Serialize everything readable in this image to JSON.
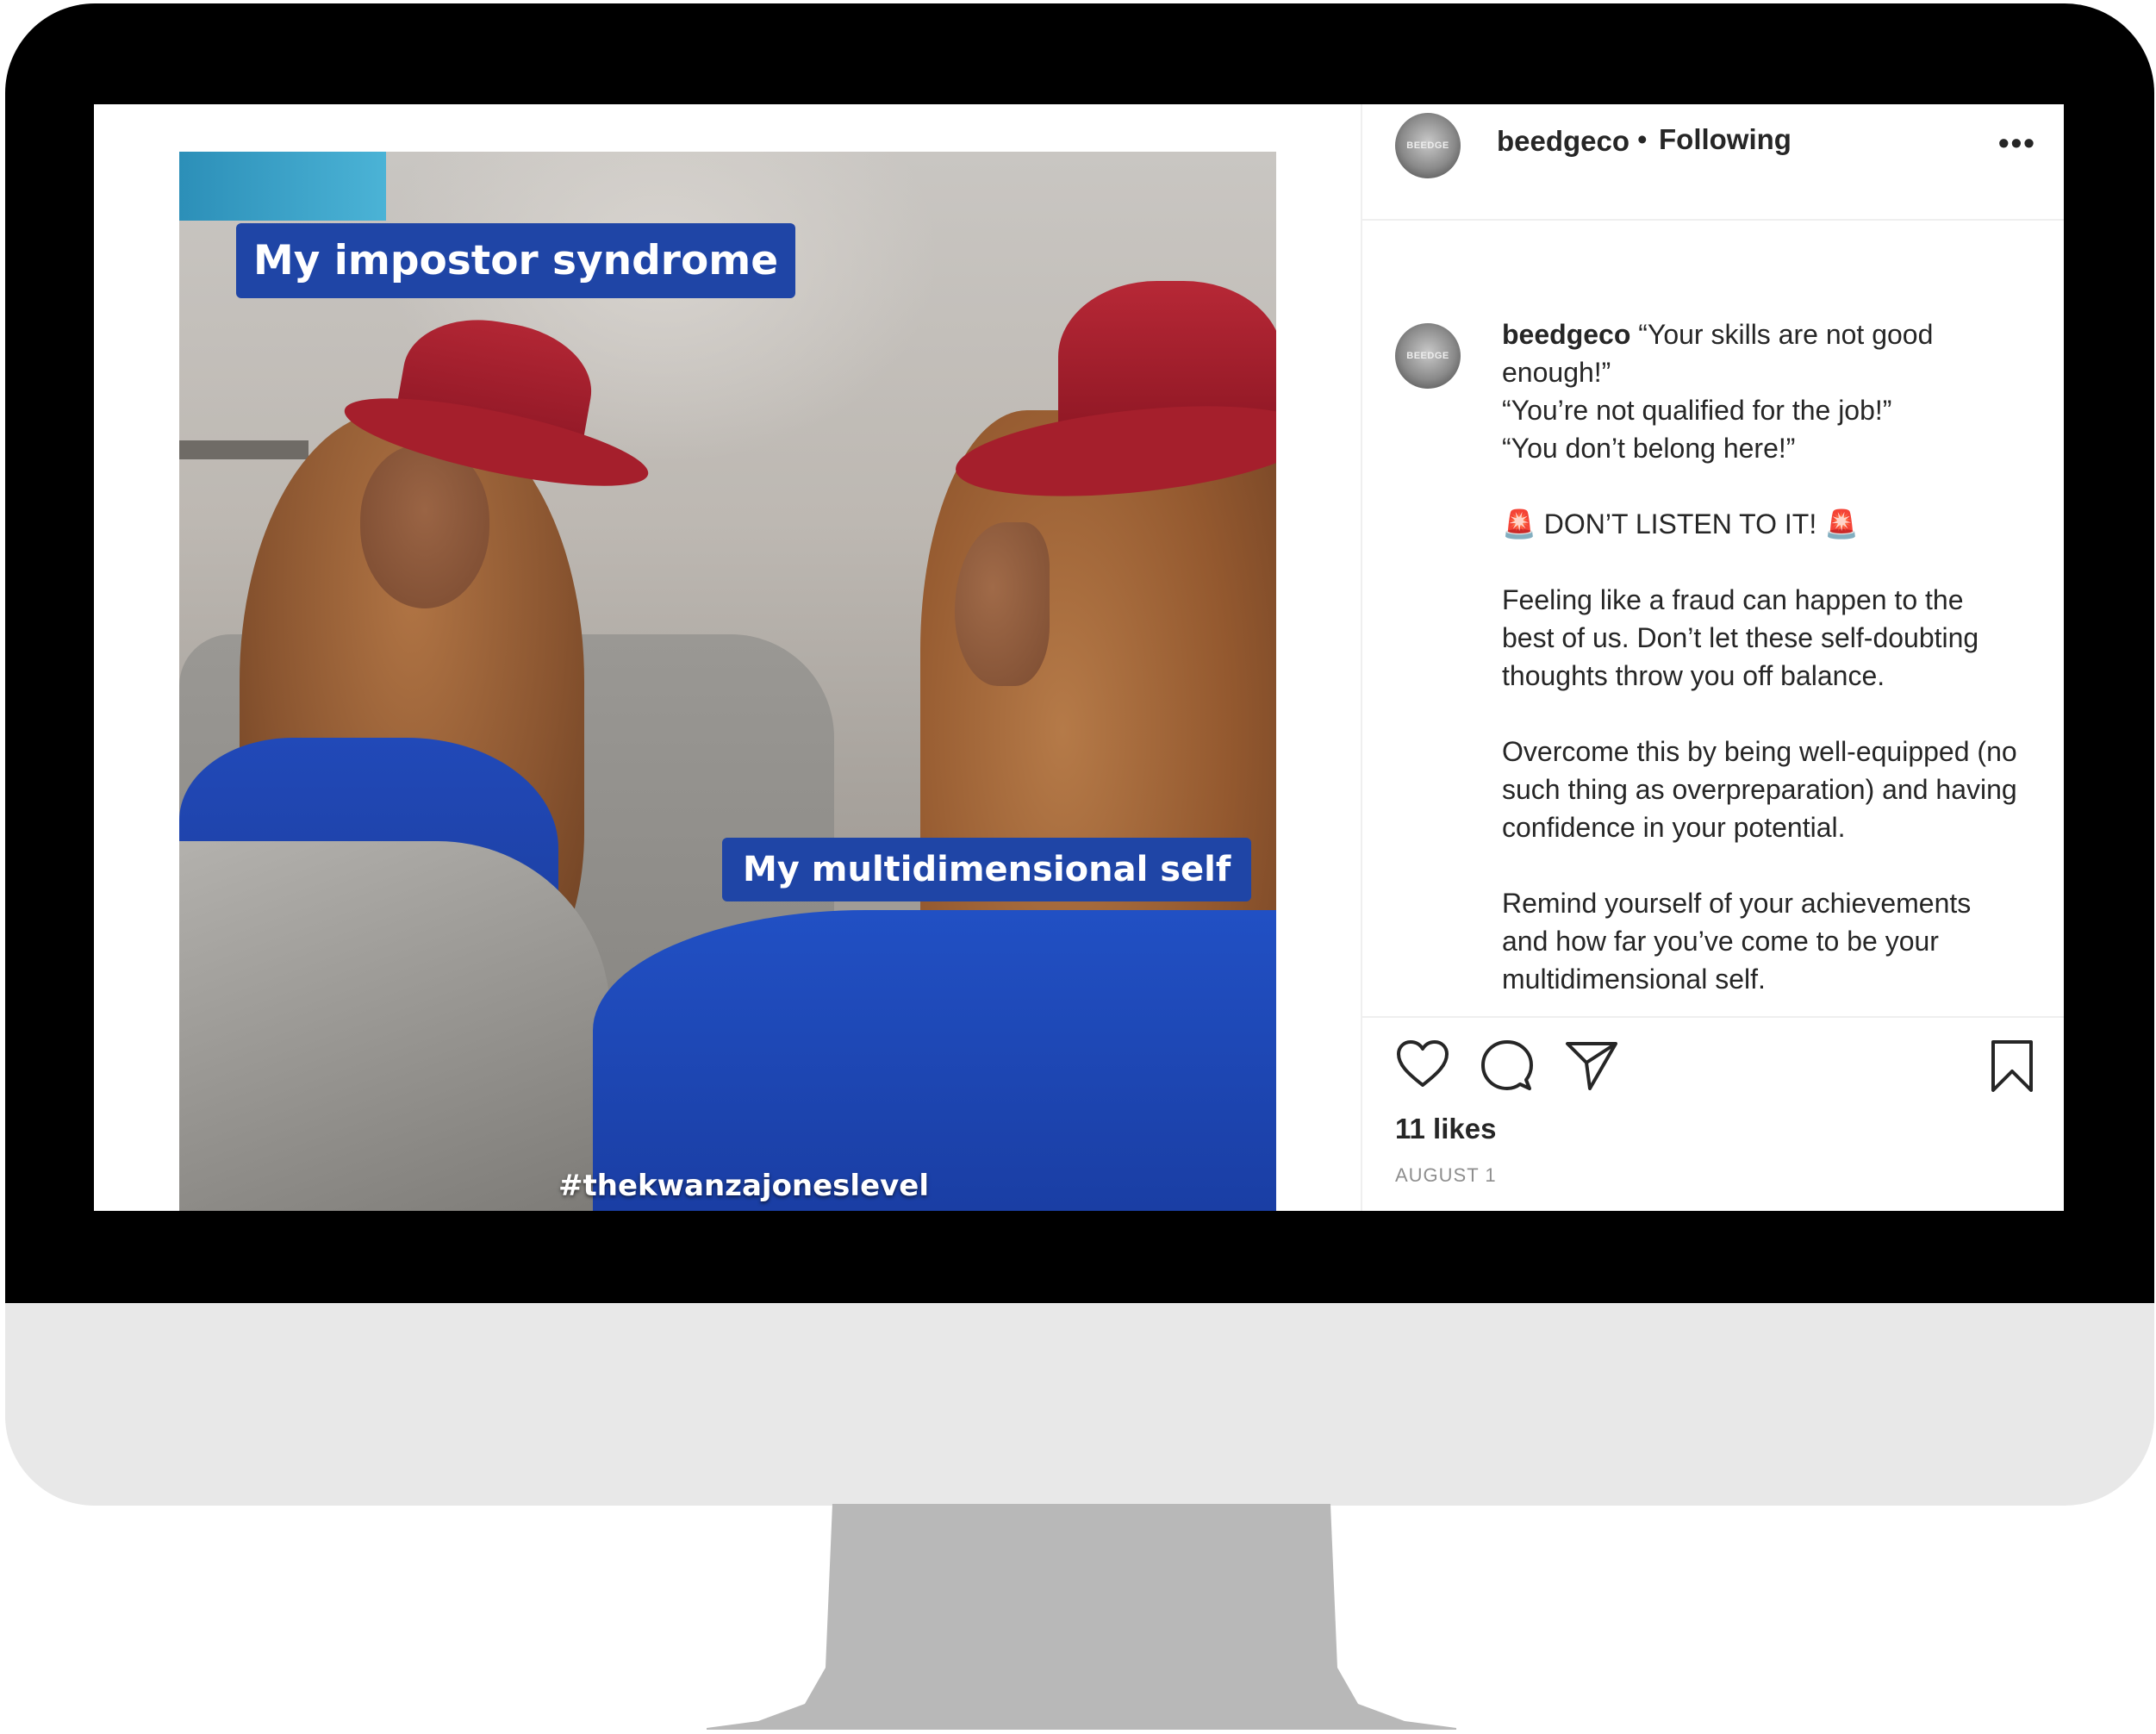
{
  "post": {
    "media": {
      "caption_top": "My impostor syndrome",
      "caption_bottom": "My multidimensional self",
      "hashtag": "#thekwanzajoneslevel"
    },
    "header": {
      "username": "beedgeco",
      "separator": "•",
      "follow_status": "Following",
      "more_icon": "•••"
    },
    "caption": {
      "username": "beedgeco",
      "text": " “Your skills are not good enough!”\n“You’re not qualified for the job!”\n“You don’t belong here!”\n\n🚨 DON’T LISTEN TO IT! 🚨\n\nFeeling like a fraud can happen to the best of us. Don’t let these self-doubting thoughts throw you off balance.\n\nOvercome this by being well-equipped (no such thing as overpreparation) and having confidence in your potential.\n\nRemind yourself of your achievements and how far you’ve come to be your multidimensional self."
    },
    "avatar_text": "BEEDGE",
    "likes": "11 likes",
    "date": "AUGUST 1",
    "icons": [
      "heart-icon",
      "comment-icon",
      "share-icon",
      "bookmark-icon",
      "more-options-icon"
    ]
  },
  "colors": {
    "caption_box": "#1f45a6",
    "text_primary": "#262626",
    "text_secondary": "#8e8e8e",
    "monitor_bezel": "#000000",
    "monitor_chin": "#e8e8e8",
    "monitor_stand": "#b8b8b8"
  }
}
